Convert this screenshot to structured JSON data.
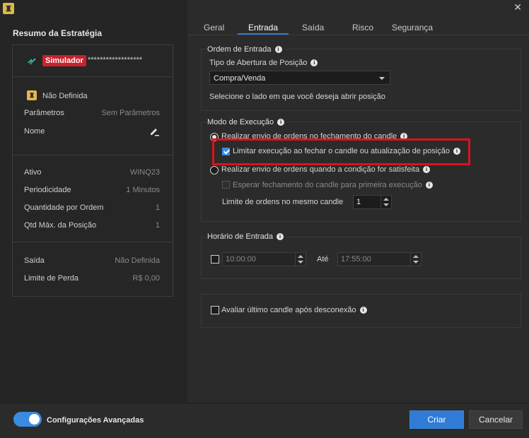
{
  "window": {
    "close_glyph": "✕"
  },
  "summary": {
    "title": "Resumo da Estratégia",
    "account_badge": "Simulador",
    "account_masked": "******************",
    "strategy_name_status": "Não Definida",
    "rows_top": [
      {
        "label": "Parâmetros",
        "value": "Sem Parâmetros"
      },
      {
        "label": "Nome",
        "value": ""
      }
    ],
    "rows_mid": [
      {
        "label": "Ativo",
        "value": "WINQ23"
      },
      {
        "label": "Periodicidade",
        "value": "1 Minutos"
      },
      {
        "label": "Quantidade por Ordem",
        "value": "1"
      },
      {
        "label": "Qtd Máx. da Posição",
        "value": "1"
      }
    ],
    "rows_bot": [
      {
        "label": "Saída",
        "value": "Não Definida"
      },
      {
        "label": "Limite de Perda",
        "value": "R$ 0,00"
      }
    ]
  },
  "tabs": [
    "Geral",
    "Entrada",
    "Saída",
    "Risco",
    "Segurança"
  ],
  "active_tab": "Entrada",
  "ordem_entrada": {
    "title": "Ordem de Entrada",
    "tipo_label": "Tipo de Abertura de Posição",
    "tipo_value": "Compra/Venda",
    "hint": "Selecione o lado em que você deseja abrir posição"
  },
  "modo_execucao": {
    "title": "Modo de Execução",
    "opt_close": "Realizar envio de ordens no fechamento do candle",
    "limit_check": "Limitar execução ao fechar o candle ou atualização de posição",
    "opt_condition": "Realizar envio de ordens quando a condição for satisfeita",
    "wait_close": "Esperar fechamento do candle para primeira execução",
    "limit_orders_label": "Limite de ordens no mesmo candle",
    "limit_orders_value": "1"
  },
  "horario": {
    "title": "Horário de Entrada",
    "from": "10:00:00",
    "ate_label": "Até",
    "to": "17:55:00"
  },
  "avaliar": {
    "label": "Avaliar último candle após desconexão"
  },
  "footer": {
    "advanced_label": "Configurações Avançadas",
    "create": "Criar",
    "cancel": "Cancelar"
  },
  "colors": {
    "accent": "#2f7bd6",
    "highlight": "#e0101c",
    "badge": "#c8232c"
  }
}
